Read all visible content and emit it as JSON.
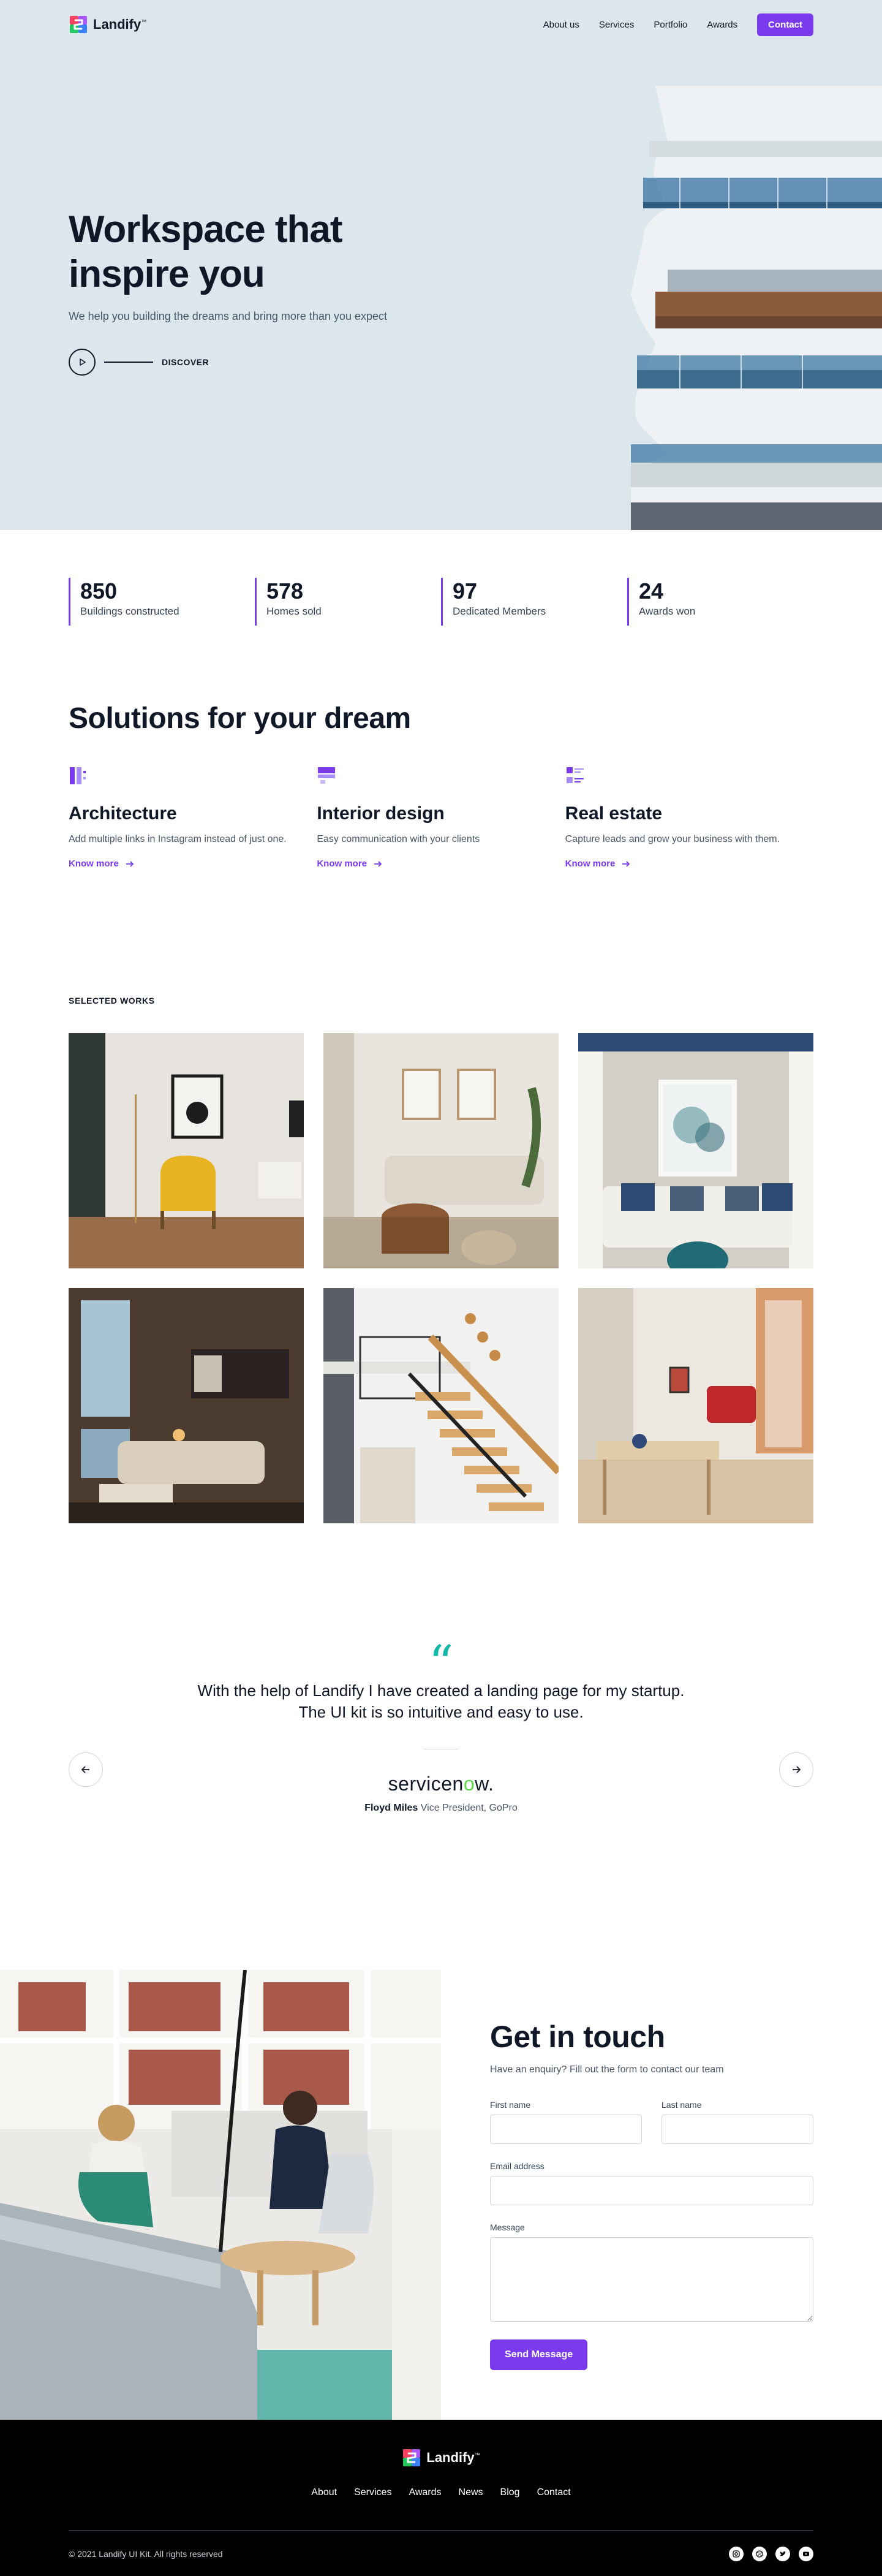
{
  "brand": {
    "name": "Landify",
    "tm": "™",
    "colors": {
      "accent": "#7c3aed",
      "hero_bg": "#dbe7ed",
      "quote": "#14b8a6"
    }
  },
  "nav": {
    "items": [
      {
        "label": "About us"
      },
      {
        "label": "Services"
      },
      {
        "label": "Portfolio"
      },
      {
        "label": "Awards"
      }
    ],
    "cta": "Contact"
  },
  "hero": {
    "title_line1": "Workspace that",
    "title_line2": "inspire you",
    "subtitle": "We help you building the dreams and bring more than you expect",
    "discover": "DISCOVER"
  },
  "stats": [
    {
      "value": "850",
      "label": "Buildings constructed"
    },
    {
      "value": "578",
      "label": "Homes sold"
    },
    {
      "value": "97",
      "label": "Dedicated Members"
    },
    {
      "value": "24",
      "label": "Awards won"
    }
  ],
  "solutions": {
    "title": "Solutions for your dream",
    "items": [
      {
        "title": "Architecture",
        "desc": "Add multiple links in Instagram instead of just one.",
        "link": "Know more",
        "icon": "columns-icon"
      },
      {
        "title": "Interior design",
        "desc": "Easy communication with your clients",
        "link": "Know more",
        "icon": "layout-icon"
      },
      {
        "title": "Real estate",
        "desc": "Capture leads and grow your business with them.",
        "link": "Know more",
        "icon": "list-icon"
      }
    ]
  },
  "works": {
    "label": "SELECTED WORKS",
    "items": [
      {
        "name": "yellow-chair-room"
      },
      {
        "name": "beige-sofa-room"
      },
      {
        "name": "blue-pillows-room"
      },
      {
        "name": "loft-living-room"
      },
      {
        "name": "wooden-staircase"
      },
      {
        "name": "red-chair-dining"
      }
    ]
  },
  "testimonial": {
    "quote_mark": "“",
    "quote_line1": "With the help of Landify I have created a landing page for my startup.",
    "quote_line2": "The UI kit is so intuitive and easy to use.",
    "company_main": "servicen",
    "company_o": "o",
    "company_end": "w.",
    "author_name": "Floyd Miles",
    "author_role": "Vice President, GoPro"
  },
  "contact": {
    "title": "Get in touch",
    "subtitle": "Have an enquiry? Fill out the form to contact our team",
    "first_name_label": "First name",
    "last_name_label": "Last name",
    "email_label": "Email address",
    "message_label": "Message",
    "send": "Send Message"
  },
  "footer": {
    "links": [
      {
        "label": "About"
      },
      {
        "label": "Services"
      },
      {
        "label": "Awards"
      },
      {
        "label": "News"
      },
      {
        "label": "Blog"
      },
      {
        "label": "Contact"
      }
    ],
    "copyright": "© 2021 Landify UI Kit. All rights reserved",
    "socials": [
      "instagram-icon",
      "dribbble-icon",
      "twitter-icon",
      "youtube-icon"
    ]
  }
}
